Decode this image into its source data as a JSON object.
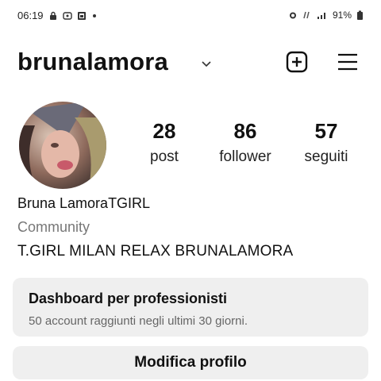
{
  "status_bar": {
    "time": "06:19",
    "battery": "91%",
    "left_icons": [
      "lock-icon",
      "message-icon",
      "gallery-icon",
      "dot-icon"
    ],
    "right_icons": [
      "alarm-icon",
      "network-icon",
      "signal-icon",
      "battery-icon"
    ]
  },
  "header": {
    "username": "brunalamora",
    "icons": [
      "chevron-down-icon",
      "add-square-icon",
      "hamburger-menu-icon"
    ]
  },
  "stats": [
    {
      "count": "28",
      "label": "post"
    },
    {
      "count": "86",
      "label": "follower"
    },
    {
      "count": "57",
      "label": "seguiti"
    }
  ],
  "profile": {
    "name": "Bruna LamoraTGIRL",
    "category": "Community",
    "bio": "T.GIRL MILAN RELAX BRUNALAMORA"
  },
  "dashboard": {
    "title": "Dashboard per professionisti",
    "subtitle": "50 account raggiunti negli ultimi 30 giorni."
  },
  "edit_profile_label": "Modifica profilo"
}
